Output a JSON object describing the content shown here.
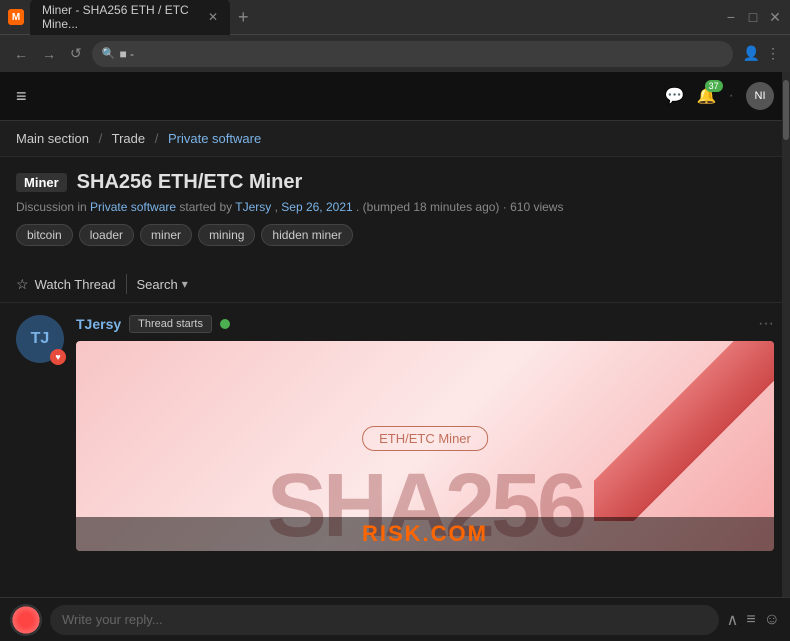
{
  "browser": {
    "tab_title": "Miner - SHA256 ETH / ETC Mine...",
    "tab_icon": "M",
    "new_tab": "+",
    "address": "■ -",
    "window_controls": {
      "minimize": "−",
      "maximize": "□",
      "close": "✕"
    },
    "nav": {
      "back": "←",
      "forward": "→",
      "refresh": "↺",
      "search_icon": "🔍"
    }
  },
  "forum": {
    "header": {
      "hamburger": "≡",
      "notification_count": "37",
      "user_initials": "NI"
    },
    "breadcrumb": {
      "main": "Main section",
      "sep1": "/",
      "trade": "Trade",
      "sep2": "/",
      "current": "Private software"
    },
    "thread": {
      "badge": "Miner",
      "title": "SHA256 ETH/ETC Miner",
      "meta_prefix": "Discussion in ",
      "meta_section": "Private software",
      "meta_by": " started by ",
      "meta_author": "TJersy",
      "meta_sep": ",",
      "meta_date": " Sep 26, 2021",
      "meta_bumped": ". (bumped 18 minutes ago)",
      "meta_views": " · 610 views",
      "tags": [
        "bitcoin",
        "loader",
        "miner",
        "mining",
        "hidden miner"
      ]
    },
    "actions": {
      "watch_label": "Watch Thread",
      "search_label": "Search",
      "dropdown_arrow": "▾"
    },
    "post": {
      "avatar_initials": "TJ",
      "username": "TJersy",
      "thread_starts_badge": "Thread starts",
      "more_icon": "···",
      "banner_label": "ETH/ETC Miner",
      "banner_sha": "SHA256",
      "watermark": "RISK.COM"
    },
    "reply": {
      "placeholder": "Write your reply...",
      "chevron_up": "∧",
      "list_icon": "≡",
      "emoji_icon": "☺"
    }
  }
}
